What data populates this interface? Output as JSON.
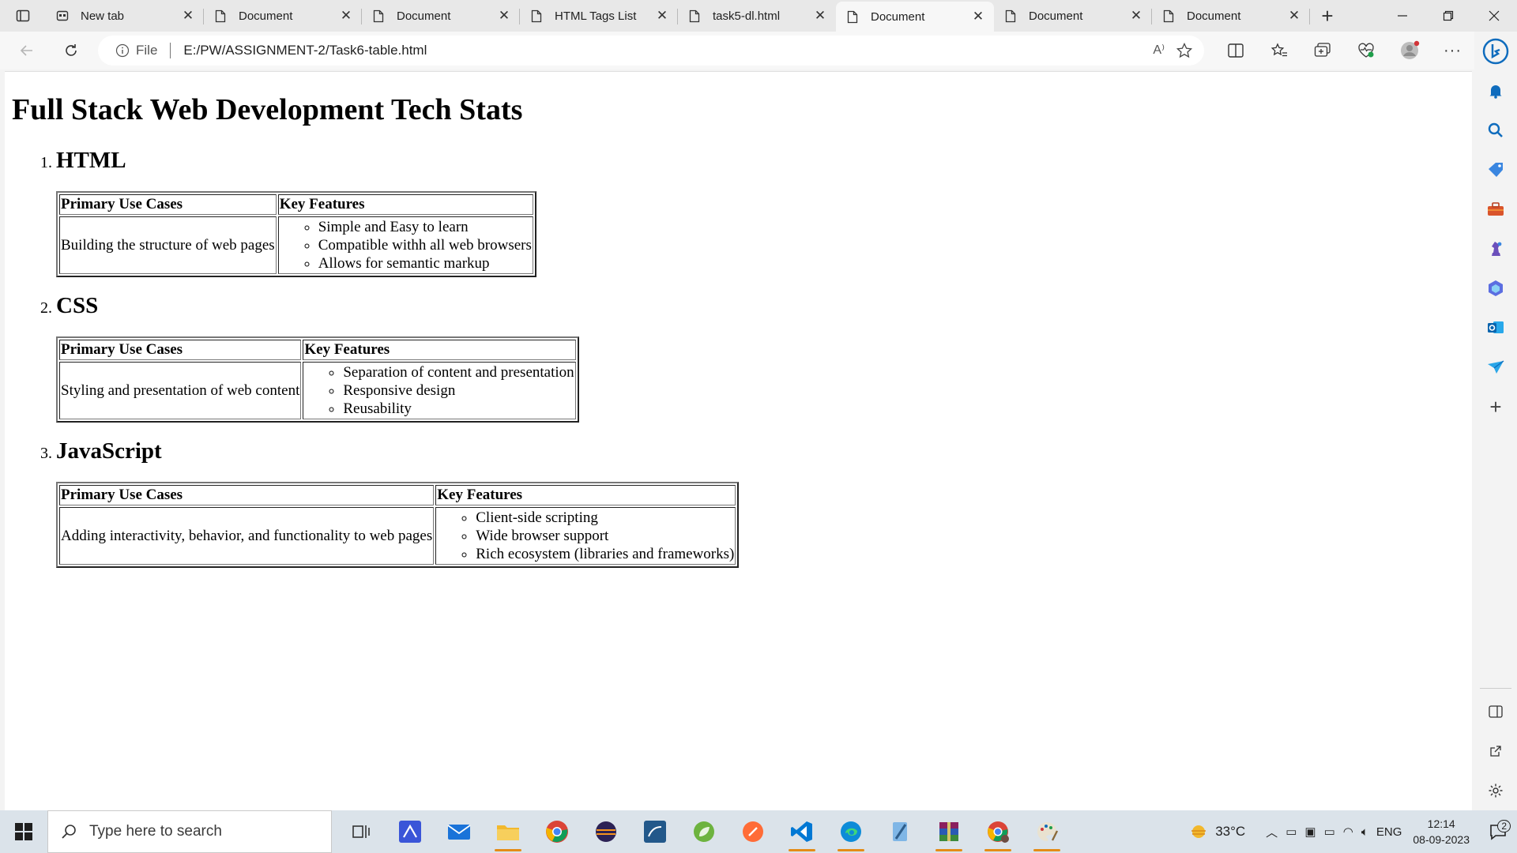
{
  "browser": {
    "tabs": [
      {
        "title": "New tab",
        "icon": "newtab-icon"
      },
      {
        "title": "Document",
        "icon": "document-icon"
      },
      {
        "title": "Document",
        "icon": "document-icon"
      },
      {
        "title": "HTML Tags List",
        "icon": "document-icon"
      },
      {
        "title": "task5-dl.html",
        "icon": "document-icon"
      },
      {
        "title": "Document",
        "icon": "document-icon",
        "active": true
      },
      {
        "title": "Document",
        "icon": "document-icon"
      },
      {
        "title": "Document",
        "icon": "document-icon"
      }
    ],
    "address": {
      "scheme_label": "File",
      "url": "E:/PW/ASSIGNMENT-2/Task6-table.html"
    },
    "read_aloud_label": "A⁾"
  },
  "page": {
    "heading": "Full Stack Web Development Tech Stats",
    "table_headers": {
      "use": "Primary Use Cases",
      "features": "Key Features"
    },
    "sections": [
      {
        "number": "1.",
        "name": "HTML",
        "use_case": "Building the structure of web pages",
        "features": [
          "Simple and Easy to learn",
          "Compatible withh all web browsers",
          "Allows for semantic markup"
        ]
      },
      {
        "number": "2.",
        "name": "CSS",
        "use_case": "Styling and presentation of web content",
        "features": [
          "Separation of content and presentation",
          "Responsive design",
          "Reusability"
        ]
      },
      {
        "number": "3.",
        "name": "JavaScript",
        "use_case": "Adding interactivity, behavior, and functionality to web pages",
        "features": [
          "Client-side scripting",
          "Wide browser support",
          "Rich ecosystem (libraries and frameworks)"
        ]
      }
    ]
  },
  "taskbar": {
    "search_placeholder": "Type here to search",
    "weather": "33°C",
    "language": "ENG",
    "time": "12:14",
    "date": "08-09-2023",
    "notification_count": "2"
  },
  "colors": {
    "accent": "#0f6cbd",
    "page_bg": "#ffffff",
    "chrome_bg": "#f7f7f7"
  }
}
